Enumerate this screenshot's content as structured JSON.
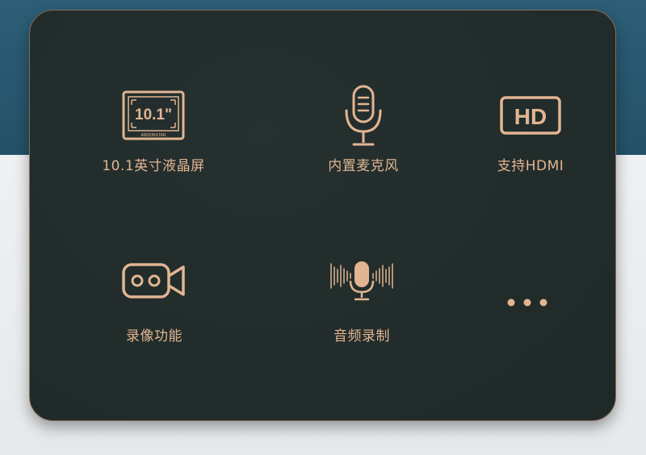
{
  "colors": {
    "accent": "#e2b592",
    "panel": "#222c2b",
    "top_band": "#2a5a72",
    "bottom_band": "#eceff1"
  },
  "features": [
    {
      "label": "10.1英寸液晶屏",
      "icon": "screen-icon",
      "screen_text": "10.1\"",
      "brand": "ANDONSTAR"
    },
    {
      "label": "内置麦克风",
      "icon": "microphone-icon"
    },
    {
      "label": "支持HDMI",
      "icon": "hd-icon",
      "badge_text": "HD"
    },
    {
      "label": "录像功能",
      "icon": "video-camera-icon"
    },
    {
      "label": "音频录制",
      "icon": "audio-waveform-microphone-icon"
    },
    {
      "label": "",
      "icon": "more-dots-icon"
    }
  ]
}
